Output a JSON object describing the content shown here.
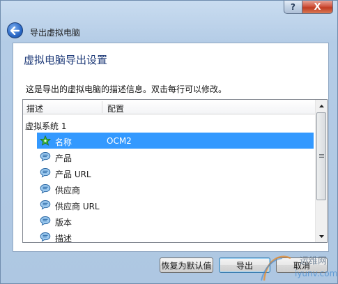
{
  "window": {
    "title": "导出虚拟电脑",
    "help_label": "?",
    "close_label": "X"
  },
  "panel": {
    "heading": "虚拟电脑导出设置",
    "description": "这是导出的虚拟电脑的描述信息。双击每行可以修改。"
  },
  "list": {
    "columns": [
      "描述",
      "配置"
    ],
    "group_label": "虚拟系统 1",
    "rows": [
      {
        "name": "名称",
        "value": "OCM2",
        "icon": "star-icon",
        "selected": true
      },
      {
        "name": "产品",
        "value": "",
        "icon": "speech-bubble-icon",
        "selected": false
      },
      {
        "name": "产品 URL",
        "value": "",
        "icon": "speech-bubble-icon",
        "selected": false
      },
      {
        "name": "供应商",
        "value": "",
        "icon": "speech-bubble-icon",
        "selected": false
      },
      {
        "name": "供应商 URL",
        "value": "",
        "icon": "speech-bubble-icon",
        "selected": false
      },
      {
        "name": "版本",
        "value": "",
        "icon": "speech-bubble-icon",
        "selected": false
      },
      {
        "name": "描述",
        "value": "",
        "icon": "speech-bubble-icon",
        "selected": false
      }
    ]
  },
  "buttons": {
    "restore_defaults": "恢复为默认值",
    "export": "导出",
    "cancel": "取消"
  },
  "watermark": {
    "text_cn": "运维网",
    "text_url": "iyunv.com"
  },
  "colors": {
    "selection": "#3399ff",
    "heading": "#1e3a78"
  }
}
